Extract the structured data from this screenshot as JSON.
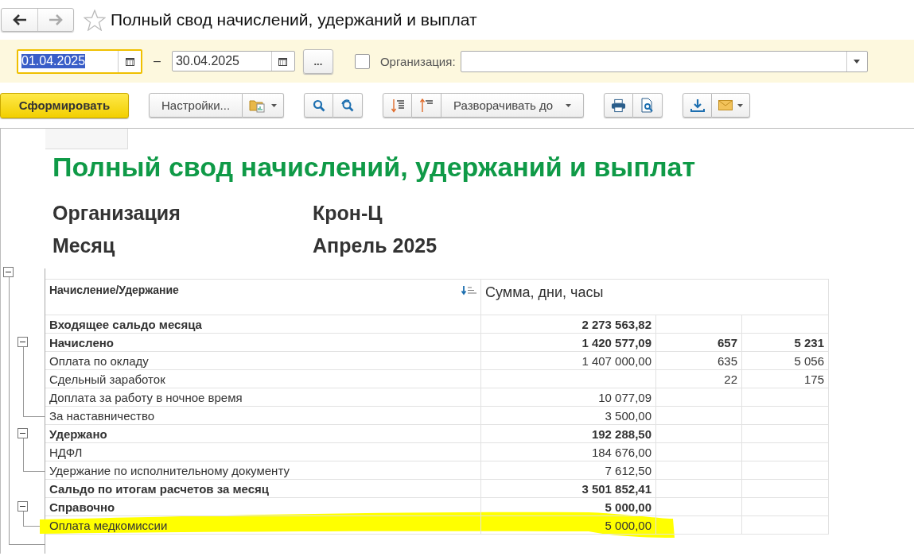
{
  "nav": {
    "back_enabled": true,
    "forward_enabled": false
  },
  "favorite": false,
  "title": "Полный свод начислений, удержаний и выплат",
  "filters": {
    "date_from": {
      "value": "01.04.2025",
      "focused": true
    },
    "dash": "–",
    "date_to": {
      "value": "30.04.2025",
      "focused": false
    },
    "more_button": "...",
    "organization": {
      "checked": false,
      "label": "Организация:"
    }
  },
  "toolbar": {
    "generate": "Сформировать",
    "settings": "Настройки...",
    "expand": "Разворачивать до"
  },
  "report": {
    "title": "Полный свод начислений, удержаний и выплат",
    "params": [
      {
        "label": "Организация",
        "value": "Крон-Ц"
      },
      {
        "label": "Месяц",
        "value": "Апрель 2025"
      }
    ],
    "expanded": true,
    "columns": [
      "Начисление/Удержание",
      "Сумма, дни, часы"
    ],
    "rows": [
      {
        "name": "Входящее сальдо месяца",
        "sum": "2 273 563,82"
      },
      {
        "name": "Начислено",
        "sum": "1 420 577,09",
        "days": "657",
        "hours": "5 231",
        "expanded": true,
        "children": [
          {
            "name": "Оплата по окладу",
            "sum": "1 407 000,00",
            "days": "635",
            "hours": "5 056"
          },
          {
            "name": "Сдельный заработок",
            "days": "22",
            "hours": "175"
          },
          {
            "name": "Доплата за работу в ночное время",
            "sum": "10 077,09"
          },
          {
            "name": "За наставничество",
            "sum": "3 500,00"
          }
        ]
      },
      {
        "name": "Удержано",
        "sum": "192 288,50",
        "expanded": true,
        "children": [
          {
            "name": "НДФЛ",
            "sum": "184 676,00"
          },
          {
            "name": "Удержание по исполнительному документу",
            "sum": "7 612,50"
          }
        ]
      },
      {
        "name": "Сальдо по итогам расчетов за месяц",
        "sum": "3 501 852,41"
      },
      {
        "name": "Справочно",
        "sum": "5 000,00",
        "expanded": true,
        "children": [
          {
            "name": "Оплата медкомиссии",
            "sum": "5 000,00",
            "highlighted": true
          }
        ]
      }
    ]
  }
}
